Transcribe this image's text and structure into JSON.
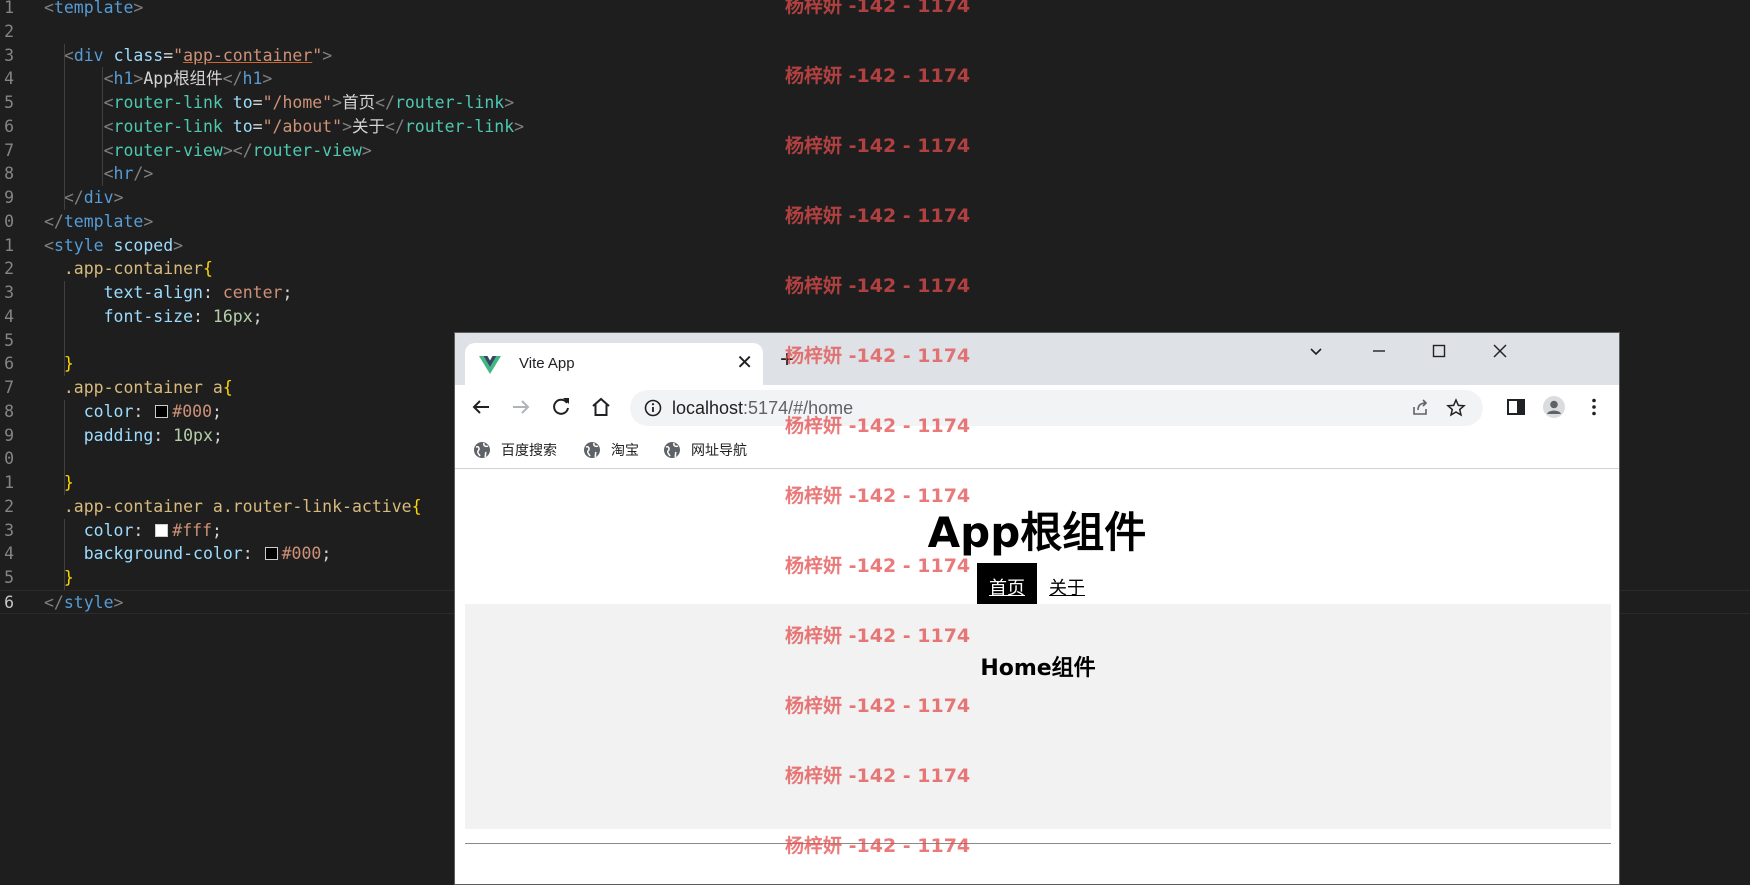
{
  "editor": {
    "lines": [
      {
        "n": "1",
        "html": "<span class='tk-brk'>&lt;</span><span class='tk-tag'>template</span><span class='tk-brk'>&gt;</span>"
      },
      {
        "n": "2",
        "html": ""
      },
      {
        "n": "3",
        "html": "  <span class='tk-brk'>&lt;</span><span class='tk-tag'>div</span> <span class='tk-attr'>class</span>=<span class='tk-str'>\"<span class='tk-ul'>app-container</span>\"</span><span class='tk-brk'>&gt;</span>"
      },
      {
        "n": "4",
        "html": "      <span class='tk-brk'>&lt;</span><span class='tk-tag'>h1</span><span class='tk-brk'>&gt;</span>App根组件<span class='tk-brk'>&lt;/</span><span class='tk-tag'>h1</span><span class='tk-brk'>&gt;</span>"
      },
      {
        "n": "5",
        "html": "      <span class='tk-brk'>&lt;</span><span class='tk-cls'>router-link</span> <span class='tk-attr'>to</span>=<span class='tk-str'>\"/home\"</span><span class='tk-brk'>&gt;</span>首页<span class='tk-brk'>&lt;/</span><span class='tk-cls'>router-link</span><span class='tk-brk'>&gt;</span>"
      },
      {
        "n": "6",
        "html": "      <span class='tk-brk'>&lt;</span><span class='tk-cls'>router-link</span> <span class='tk-attr'>to</span>=<span class='tk-str'>\"/about\"</span><span class='tk-brk'>&gt;</span>关于<span class='tk-brk'>&lt;/</span><span class='tk-cls'>router-link</span><span class='tk-brk'>&gt;</span>"
      },
      {
        "n": "7",
        "html": "      <span class='tk-brk'>&lt;</span><span class='tk-cls'>router-view</span><span class='tk-brk'>&gt;&lt;/</span><span class='tk-cls'>router-view</span><span class='tk-brk'>&gt;</span>"
      },
      {
        "n": "8",
        "html": "      <span class='tk-brk'>&lt;</span><span class='tk-tag'>hr</span><span class='tk-brk'>/&gt;</span>"
      },
      {
        "n": "9",
        "html": "  <span class='tk-brk'>&lt;/</span><span class='tk-tag'>div</span><span class='tk-brk'>&gt;</span>"
      },
      {
        "n": "0",
        "html": "<span class='tk-brk'>&lt;/</span><span class='tk-tag'>template</span><span class='tk-brk'>&gt;</span>"
      },
      {
        "n": "1",
        "html": "<span class='tk-brk'>&lt;</span><span class='tk-tag'>style</span> <span class='tk-attr'>scoped</span><span class='tk-brk'>&gt;</span>"
      },
      {
        "n": "2",
        "html": "  <span class='tk-sel'>.app-container</span><span class='tk-brace'>{</span>"
      },
      {
        "n": "3",
        "html": "      <span class='tk-prop'>text-align</span>: <span class='tk-val'>center</span>;"
      },
      {
        "n": "4",
        "html": "      <span class='tk-prop'>font-size</span>: <span class='tk-num'>16px</span>;"
      },
      {
        "n": "5",
        "html": ""
      },
      {
        "n": "6",
        "html": "  <span class='tk-brace'>}</span>"
      },
      {
        "n": "7",
        "html": "  <span class='tk-sel'>.app-container a</span><span class='tk-brace'>{</span>"
      },
      {
        "n": "8",
        "html": "    <span class='tk-prop'>color</span>: <span class='swatch' style='background:#000'></span><span class='tk-val'>#000</span>;"
      },
      {
        "n": "9",
        "html": "    <span class='tk-prop'>padding</span>: <span class='tk-num'>10px</span>;"
      },
      {
        "n": "0",
        "html": ""
      },
      {
        "n": "1",
        "html": "  <span class='tk-brace'>}</span>"
      },
      {
        "n": "2",
        "html": "  <span class='tk-sel'>.app-container a.router-link-active</span><span class='tk-brace'>{</span>"
      },
      {
        "n": "3",
        "html": "    <span class='tk-prop'>color</span>: <span class='swatch' style='background:#fff'></span><span class='tk-val'>#fff</span>;"
      },
      {
        "n": "4",
        "html": "    <span class='tk-prop'>background-color</span>: <span class='swatch' style='background:#000'></span><span class='tk-val'>#000</span>;"
      },
      {
        "n": "5",
        "html": "  <span class='tk-brace'>}</span>"
      },
      {
        "n": "6",
        "html": "<span class='tk-brk'>&lt;/</span><span class='tk-tag'>style</span><span class='tk-brk'>&gt;</span>"
      }
    ]
  },
  "browser": {
    "tab_title": "Vite App",
    "tab_close": "✕",
    "new_tab": "+",
    "url_host": "localhost",
    "url_rest": ":5174/#/home",
    "bookmarks": [
      "百度搜索",
      "淘宝",
      "网址导航"
    ]
  },
  "page": {
    "title": "App根组件",
    "link_home": "首页",
    "link_about": "关于",
    "home_title": "Home组件"
  },
  "watermark": {
    "text": "杨梓妍 -142 - 1174"
  },
  "colors": {
    "editor_bg": "#1e1e1e",
    "watermark": "#e34d4d",
    "active_link_bg": "#000000"
  }
}
